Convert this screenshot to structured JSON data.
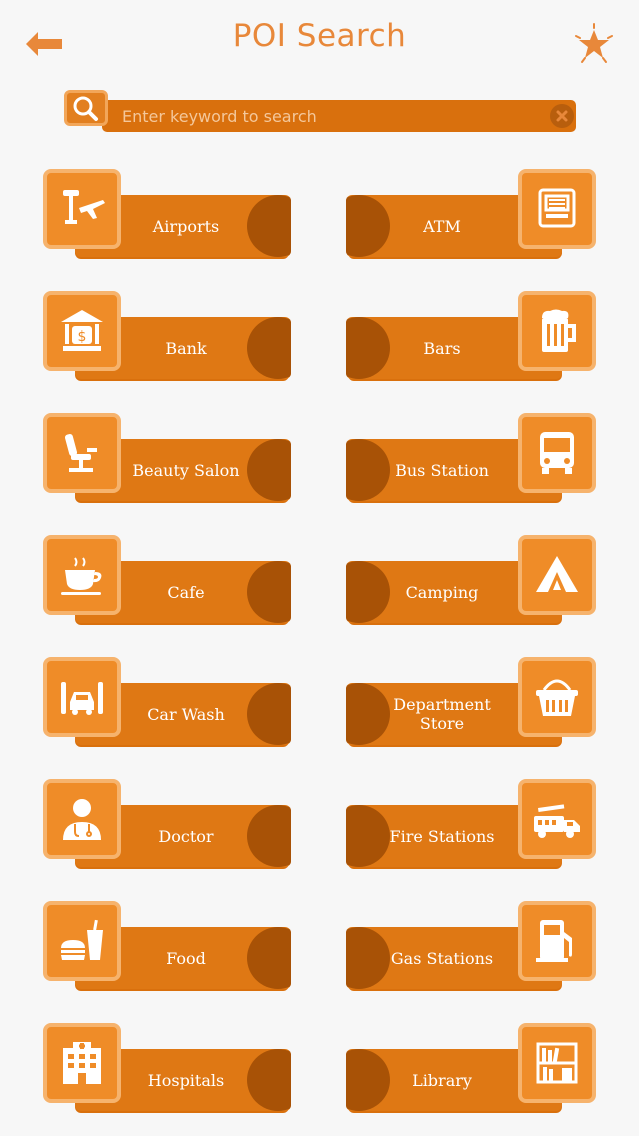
{
  "header": {
    "title": "POI Search",
    "back_icon": "back-arrow-icon",
    "favorite_icon": "star-icon"
  },
  "search": {
    "placeholder": "Enter keyword to search",
    "value": "",
    "search_icon": "magnifier-icon",
    "clear_icon": "close-icon"
  },
  "colors": {
    "accent": "#e8883a",
    "band": "#df7814",
    "band_dark": "#a85206",
    "icon_box": "#ef8c28",
    "icon_border": "#f6b36d",
    "background": "#f7f7f7"
  },
  "categories": [
    {
      "label": "Airports",
      "icon": "airport-icon"
    },
    {
      "label": "ATM",
      "icon": "atm-icon"
    },
    {
      "label": "Bank",
      "icon": "bank-icon"
    },
    {
      "label": "Bars",
      "icon": "beer-icon"
    },
    {
      "label": "Beauty Salon",
      "icon": "salon-chair-icon"
    },
    {
      "label": "Bus Station",
      "icon": "bus-icon"
    },
    {
      "label": "Cafe",
      "icon": "coffee-cup-icon"
    },
    {
      "label": "Camping",
      "icon": "tent-icon"
    },
    {
      "label": "Car Wash",
      "icon": "car-wash-icon"
    },
    {
      "label": "Department\nStore",
      "icon": "shopping-basket-icon"
    },
    {
      "label": "Doctor",
      "icon": "doctor-icon"
    },
    {
      "label": "Fire Stations",
      "icon": "fire-truck-icon"
    },
    {
      "label": "Food",
      "icon": "fast-food-icon"
    },
    {
      "label": "Gas Stations",
      "icon": "fuel-pump-icon"
    },
    {
      "label": "Hospitals",
      "icon": "hospital-icon"
    },
    {
      "label": "Library",
      "icon": "bookshelf-icon"
    }
  ]
}
